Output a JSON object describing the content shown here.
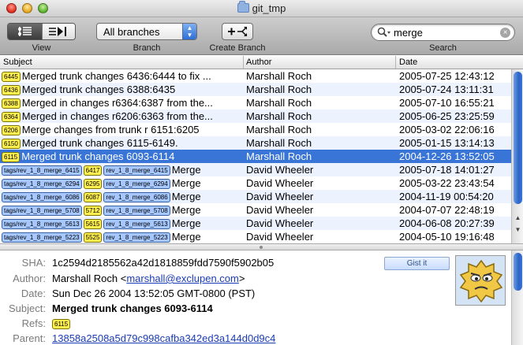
{
  "window": {
    "title": "git_tmp"
  },
  "toolbar": {
    "view_label": "View",
    "branch_label": "Branch",
    "branch_value": "All branches",
    "create_branch_label": "Create Branch",
    "search_label": "Search",
    "search_value": "merge"
  },
  "columns": {
    "subject": "Subject",
    "author": "Author",
    "date": "Date"
  },
  "commits": [
    {
      "tags": [
        "6445"
      ],
      "subject": "Merged trunk changes 6436:6444 to fix ...",
      "author": "Marshall Roch",
      "date": "2005-07-25 12:43:12"
    },
    {
      "tags": [
        "6436"
      ],
      "subject": "Merged trunk changes 6388:6435",
      "author": "Marshall Roch",
      "date": "2005-07-24 13:11:31"
    },
    {
      "tags": [
        "6388"
      ],
      "subject": "Merged in changes r6364:6387 from the...",
      "author": "Marshall Roch",
      "date": "2005-07-10 16:55:21"
    },
    {
      "tags": [
        "6364"
      ],
      "subject": "Merged in changes r6206:6363 from the...",
      "author": "Marshall Roch",
      "date": "2005-06-25 23:25:59"
    },
    {
      "tags": [
        "6206"
      ],
      "subject": "Merge changes from trunk r 6151:6205",
      "author": "Marshall Roch",
      "date": "2005-03-02 22:06:16"
    },
    {
      "tags": [
        "6150"
      ],
      "subject": "Merged trunk changes 6115-6149.",
      "author": "Marshall Roch",
      "date": "2005-01-15 13:14:13"
    },
    {
      "tags": [
        "6115"
      ],
      "subject": "Merged trunk changes 6093-6114",
      "author": "Marshall Roch",
      "date": "2004-12-26 13:52:05",
      "selected": true
    },
    {
      "tags": [
        "tags/rev_1_8_merge_6415",
        "6417",
        "rev_1_8_merge_6415"
      ],
      "subject": "Merge",
      "author": "David Wheeler",
      "date": "2005-07-18 14:01:27"
    },
    {
      "tags": [
        "tags/rev_1_8_merge_6294",
        "6295",
        "rev_1_8_merge_6294"
      ],
      "subject": "Merge",
      "author": "David Wheeler",
      "date": "2005-03-22 23:43:54"
    },
    {
      "tags": [
        "tags/rev_1_8_merge_6086",
        "6087",
        "rev_1_8_merge_6086"
      ],
      "subject": "Merge",
      "author": "David Wheeler",
      "date": "2004-11-19 00:54:20"
    },
    {
      "tags": [
        "tags/rev_1_8_merge_5708",
        "5712",
        "rev_1_8_merge_5708"
      ],
      "subject": "Merge",
      "author": "David Wheeler",
      "date": "2004-07-07 22:48:19"
    },
    {
      "tags": [
        "tags/rev_1_8_merge_5613",
        "5615",
        "rev_1_8_merge_5613"
      ],
      "subject": "Merge",
      "author": "David Wheeler",
      "date": "2004-06-08 20:27:39"
    },
    {
      "tags": [
        "tags/rev_1_8_merge_5223",
        "5525",
        "rev_1_8_merge_5223"
      ],
      "subject": "Merge",
      "author": "David Wheeler",
      "date": "2004-05-10 19:16:48"
    }
  ],
  "detail": {
    "sha_label": "SHA:",
    "sha": "1c2594d2185562a42d1818859fdd7590f5902b05",
    "author_label": "Author:",
    "author_name": "Marshall Roch",
    "author_lt": "<",
    "author_email": "marshall@exclupen.com",
    "author_gt": ">",
    "date_label": "Date:",
    "date": "Sun Dec 26 2004 13:52:05 GMT-0800 (PST)",
    "subject_label": "Subject:",
    "subject": "Merged trunk changes 6093-6114",
    "refs_label": "Refs:",
    "refs": "6115",
    "parent_label": "Parent:",
    "parent": "13858a2508a5d79c998cafba342ed3a144d0d9c4",
    "gist_button": "Gist it"
  },
  "colors": {
    "selection": "#3875d7",
    "tag": "#ffef4f",
    "ref_tag": "#a6c8ff",
    "alt_row": "#edf3fe"
  }
}
